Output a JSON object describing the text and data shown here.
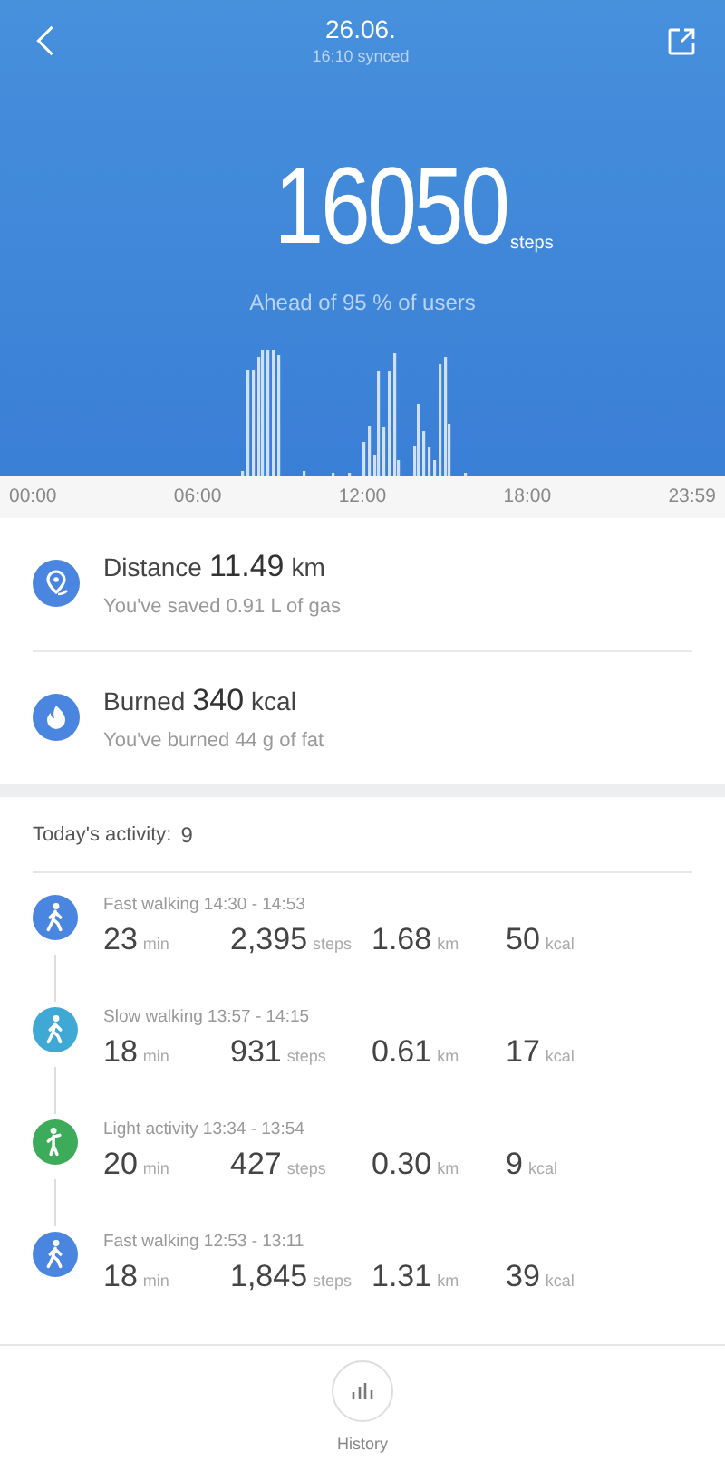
{
  "header": {
    "date": "26.06.",
    "synced": "16:10 synced",
    "steps": "16050",
    "steps_unit": "steps",
    "ranking": "Ahead of 95 % of users"
  },
  "time_axis": [
    "00:00",
    "06:00",
    "12:00",
    "18:00",
    "23:59"
  ],
  "summary": [
    {
      "kind": "distance",
      "label": "Distance",
      "value": "11.49",
      "unit": "km",
      "note": "You've saved 0.91 L  of gas"
    },
    {
      "kind": "calories",
      "label": "Burned",
      "value": "340",
      "unit": "kcal",
      "note": "You've burned 44 g  of fat"
    }
  ],
  "activity": {
    "label": "Today's activity:",
    "count": "9",
    "items": [
      {
        "kind": "walk",
        "color": "#4a86e0",
        "title": "Fast walking 14:30 - 14:53",
        "stats": [
          {
            "value": "23",
            "unit": "min"
          },
          {
            "value": "2,395",
            "unit": "steps"
          },
          {
            "value": "1.68",
            "unit": "km"
          },
          {
            "value": "50",
            "unit": "kcal"
          }
        ]
      },
      {
        "kind": "walk",
        "color": "#3fa8d4",
        "title": "Slow walking 13:57 - 14:15",
        "stats": [
          {
            "value": "18",
            "unit": "min"
          },
          {
            "value": "931",
            "unit": "steps"
          },
          {
            "value": "0.61",
            "unit": "km"
          },
          {
            "value": "17",
            "unit": "kcal"
          }
        ]
      },
      {
        "kind": "light",
        "color": "#3dac5a",
        "title": "Light activity 13:34 - 13:54",
        "stats": [
          {
            "value": "20",
            "unit": "min"
          },
          {
            "value": "427",
            "unit": "steps"
          },
          {
            "value": "0.30",
            "unit": "km"
          },
          {
            "value": "9",
            "unit": "kcal"
          }
        ]
      },
      {
        "kind": "walk",
        "color": "#4a86e0",
        "title": "Fast walking 12:53 - 13:11",
        "stats": [
          {
            "value": "18",
            "unit": "min"
          },
          {
            "value": "1,845",
            "unit": "steps"
          },
          {
            "value": "1.31",
            "unit": "km"
          },
          {
            "value": "39",
            "unit": "kcal"
          }
        ]
      }
    ]
  },
  "bottom": {
    "label": "History"
  }
}
